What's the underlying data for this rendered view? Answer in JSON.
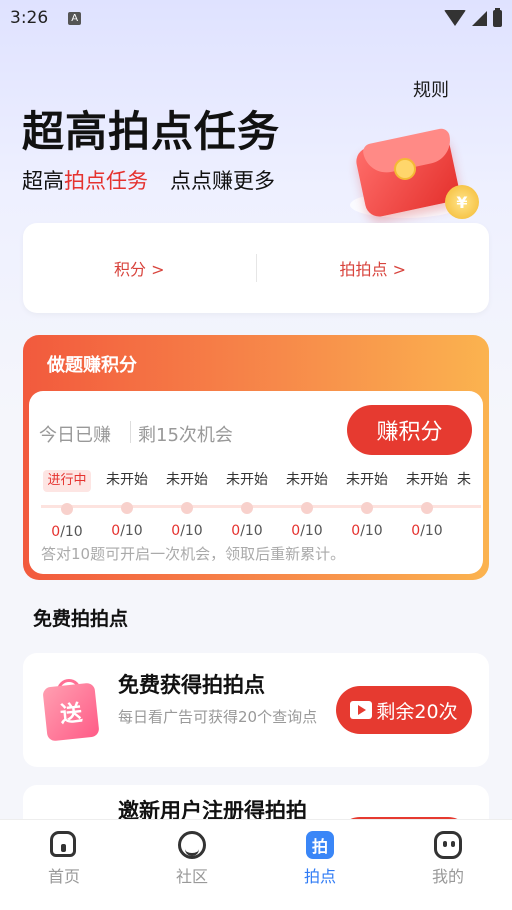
{
  "status_bar": {
    "time": "3:26",
    "badge": "A"
  },
  "header": {
    "rules": "规则",
    "headline": "超高拍点任务",
    "sub_prefix": "超高",
    "sub_highlight": "拍点任务",
    "sub_tail": "点点赚更多"
  },
  "points_card": {
    "points": "积分 >",
    "paipai": "拍拍点 >"
  },
  "quiz": {
    "title": "做题赚积分",
    "earned": "今日已赚",
    "chances": "剩15次机会",
    "earn_button": "赚积分",
    "steps": [
      {
        "label": "进行中",
        "count_done": "0",
        "count_total": "/10"
      },
      {
        "label": "未开始",
        "count_done": "0",
        "count_total": "/10"
      },
      {
        "label": "未开始",
        "count_done": "0",
        "count_total": "/10"
      },
      {
        "label": "未开始",
        "count_done": "0",
        "count_total": "/10"
      },
      {
        "label": "未开始",
        "count_done": "0",
        "count_total": "/10"
      },
      {
        "label": "未开始",
        "count_done": "0",
        "count_total": "/10"
      },
      {
        "label": "未开始",
        "count_done": "0",
        "count_total": "/10"
      },
      {
        "label": "未",
        "count_done": "",
        "count_total": ""
      }
    ],
    "note": "答对10题可开启一次机会，领取后重新累计。"
  },
  "free_section": {
    "title": "免费拍拍点",
    "tasks": [
      {
        "title": "免费获得拍拍点",
        "desc": "每日看广告可获得20个查询点",
        "button": "剩余20次",
        "icon_text": "送"
      },
      {
        "title": "邀新用户注册得拍拍"
      }
    ]
  },
  "nav": [
    {
      "label": "首页",
      "icon": "home-icon"
    },
    {
      "label": "社区",
      "icon": "community-icon"
    },
    {
      "label": "拍点",
      "icon": "paidian-icon",
      "icon_text": "拍"
    },
    {
      "label": "我的",
      "icon": "profile-icon"
    }
  ],
  "colors": {
    "accent": "#e63a30",
    "nav_active": "#2f7bf5"
  }
}
